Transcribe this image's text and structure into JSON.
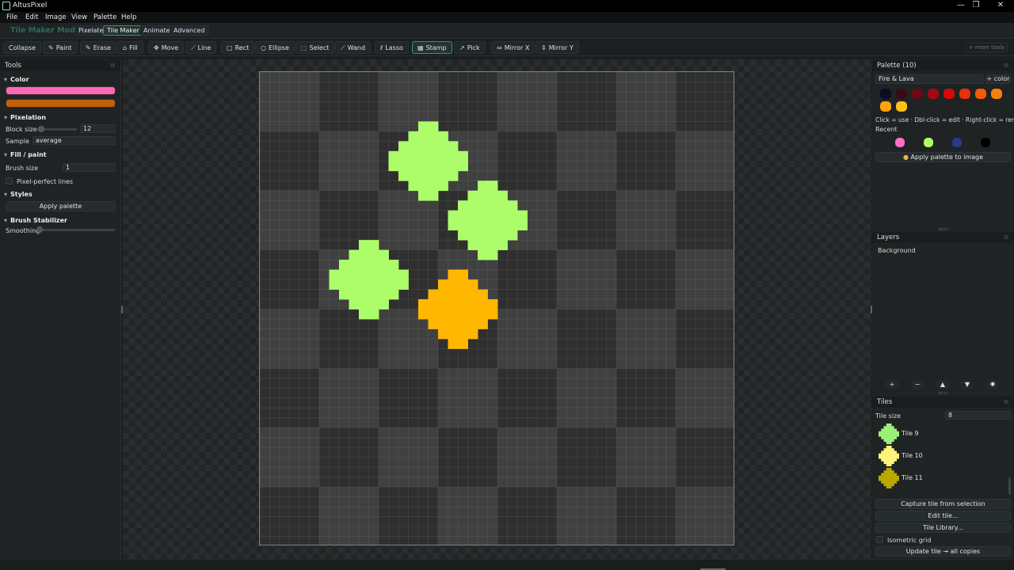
{
  "window": {
    "title": "AltusPixel",
    "controls": [
      "—",
      "❐",
      "✕"
    ]
  },
  "menu": [
    "File",
    "Edit",
    "Image",
    "View",
    "Palette",
    "Help"
  ],
  "mode_bar": {
    "title": "Tile Maker Mode",
    "modes": [
      {
        "label": "Pixelate",
        "active": false
      },
      {
        "label": "Tile Maker",
        "active": true
      },
      {
        "label": "Animate",
        "active": false
      },
      {
        "label": "Advanced",
        "active": false
      }
    ]
  },
  "toolbar": {
    "tools": [
      {
        "label": "Collapse",
        "icon": "",
        "active": false
      },
      {
        "label": "Paint",
        "icon": "✎",
        "active": false
      },
      {
        "label": "Erase",
        "icon": "✎",
        "active": false
      },
      {
        "label": "Fill",
        "icon": "⌂",
        "active": false
      },
      {
        "label": "Move",
        "icon": "✥",
        "active": false
      },
      {
        "label": "Line",
        "icon": "⟋",
        "active": false
      },
      {
        "label": "Rect",
        "icon": "□",
        "active": false
      },
      {
        "label": "Ellipse",
        "icon": "○",
        "active": false
      },
      {
        "label": "Select",
        "icon": "⬚",
        "active": false
      },
      {
        "label": "Wand",
        "icon": "⟋",
        "active": false
      },
      {
        "label": "Lasso",
        "icon": "ℓ",
        "active": false
      },
      {
        "label": "Stamp",
        "icon": "▦",
        "active": true
      },
      {
        "label": "Pick",
        "icon": "↗",
        "active": false
      },
      {
        "label": "Mirror X",
        "icon": "⇔",
        "active": false
      },
      {
        "label": "Mirror Y",
        "icon": "⇕",
        "active": false
      }
    ],
    "more_label": "+ more tools"
  },
  "tools_panel": {
    "title": "Tools",
    "color_section": "Color",
    "primary_color": "#ff69b4",
    "secondary_color": "#c0600a",
    "pixelation_section": "Pixelation",
    "block_size_label": "Block size",
    "block_size_value": "12",
    "block_size_level": 0.05,
    "sample_label": "Sample",
    "sample_value": "average",
    "fill_section": "Fill / paint",
    "brush_size_label": "Brush size",
    "brush_size_value": "1",
    "pixel_perfect_label": "Pixel-perfect lines",
    "pixel_perfect_checked": false,
    "styles_section": "Styles",
    "apply_palette_label": "Apply palette",
    "stabilizer_section": "Brush Stabilizer",
    "smoothing_label": "Smoothing",
    "smoothing_level": 0.0
  },
  "canvas": {
    "grid_cols": 48,
    "grid_rows": 48,
    "tile_cells": 6,
    "shapes": [
      {
        "color": "#adfd6b",
        "col": 14,
        "row": 6
      },
      {
        "color": "#adfd6b",
        "col": 20,
        "row": 12
      },
      {
        "color": "#adfd6b",
        "col": 8,
        "row": 18
      },
      {
        "color": "#ffb700",
        "col": 17,
        "row": 21
      }
    ]
  },
  "palette_panel": {
    "title": "Palette (10)",
    "palette_name": "Fire & Lava",
    "add_color_label": "+ color",
    "colors": [
      "#0b0c22",
      "#3a0a14",
      "#6a0a14",
      "#a10a14",
      "#d40a0a",
      "#e8300a",
      "#f25a0a",
      "#f7800a",
      "#ffa30a",
      "#ffbf1a"
    ],
    "help_text": "Click = use · Dbl-click = edit · Right-click = remove",
    "recent_label": "Recent",
    "recent_colors": [
      "#ff6ec7",
      "#b2ff66",
      "#2a3a8a",
      "#000000"
    ],
    "apply_button": "Apply palette to image"
  },
  "layers_panel": {
    "title": "Layers",
    "layers": [
      "Background"
    ],
    "buttons": [
      "+",
      "−",
      "▲",
      "▼",
      "👁"
    ]
  },
  "tiles_panel": {
    "title": "Tiles",
    "tile_size_label": "Tile size",
    "tile_size_value": "8",
    "tiles": [
      {
        "label": "Tile 9",
        "color": "#9cf07a"
      },
      {
        "label": "Tile 10",
        "color": "#fff27a"
      },
      {
        "label": "Tile 11",
        "color": "#b8a800"
      }
    ],
    "capture_button": "Capture tile from selection",
    "edit_button": "Edit tile...",
    "library_button": "Tile Library...",
    "isometric_label": "Isometric grid",
    "isometric_checked": false,
    "update_button": "Update tile → all copies"
  }
}
